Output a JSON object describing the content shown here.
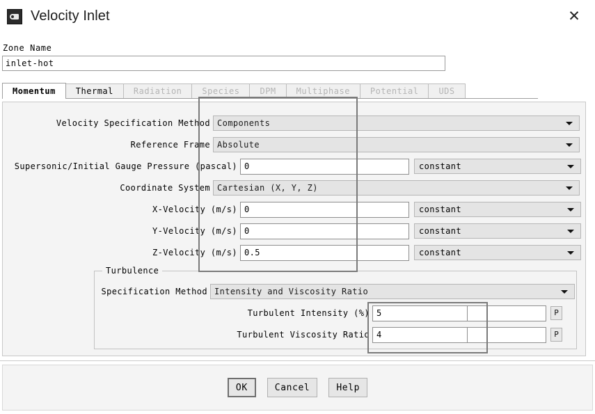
{
  "window": {
    "title": "Velocity Inlet",
    "icon": "fluent-app-icon",
    "close_label": "✕"
  },
  "zone": {
    "label": "Zone Name",
    "value": "inlet-hot"
  },
  "tabs": [
    {
      "label": "Momentum",
      "active": true,
      "enabled": true
    },
    {
      "label": "Thermal",
      "active": false,
      "enabled": true
    },
    {
      "label": "Radiation",
      "active": false,
      "enabled": false
    },
    {
      "label": "Species",
      "active": false,
      "enabled": false
    },
    {
      "label": "DPM",
      "active": false,
      "enabled": false
    },
    {
      "label": "Multiphase",
      "active": false,
      "enabled": false
    },
    {
      "label": "Potential",
      "active": false,
      "enabled": false
    },
    {
      "label": "UDS",
      "active": false,
      "enabled": false
    }
  ],
  "momentum": {
    "velocity_specification_method": {
      "label": "Velocity Specification Method",
      "value": "Components"
    },
    "reference_frame": {
      "label": "Reference Frame",
      "value": "Absolute"
    },
    "supersonic_initial_gauge_pressure": {
      "label": "Supersonic/Initial Gauge Pressure (pascal)",
      "value": "0",
      "profile": "constant"
    },
    "coordinate_system": {
      "label": "Coordinate System",
      "value": "Cartesian (X, Y, Z)"
    },
    "x_velocity": {
      "label": "X-Velocity (m/s)",
      "value": "0",
      "profile": "constant"
    },
    "y_velocity": {
      "label": "Y-Velocity (m/s)",
      "value": "0",
      "profile": "constant"
    },
    "z_velocity": {
      "label": "Z-Velocity (m/s)",
      "value": "0.5",
      "profile": "constant"
    }
  },
  "turbulence": {
    "group_label": "Turbulence",
    "specification_method": {
      "label": "Specification Method",
      "value": "Intensity and Viscosity Ratio"
    },
    "turbulent_intensity": {
      "label": "Turbulent Intensity (%)",
      "value": "5",
      "param_button": "P"
    },
    "turbulent_viscosity_ratio": {
      "label": "Turbulent Viscosity Ratio",
      "value": "4",
      "param_button": "P"
    }
  },
  "footer": {
    "ok_label": "OK",
    "cancel_label": "Cancel",
    "help_label": "Help"
  },
  "annotations": {
    "highlight_color": "#7a7a7a",
    "boxes": [
      {
        "name": "velocity-fields-highlight"
      },
      {
        "name": "turbulence-fields-highlight"
      }
    ]
  }
}
